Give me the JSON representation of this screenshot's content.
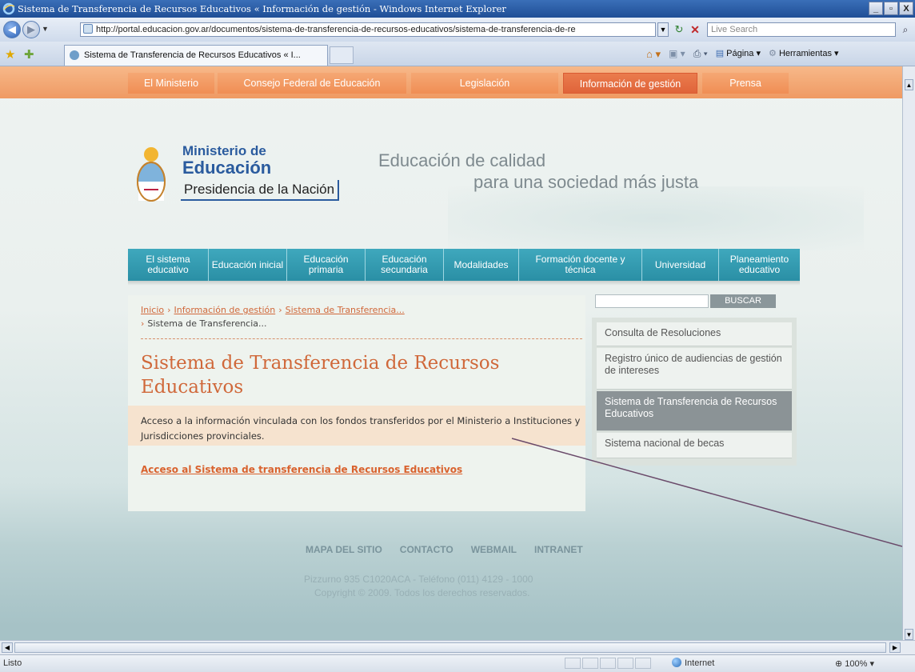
{
  "window": {
    "title": "Sistema de Transferencia de Recursos Educativos « Información de gestión - Windows Internet Explorer",
    "minimize": "_",
    "restore": "ā",
    "close": "X"
  },
  "address": {
    "url": "http://portal.educacion.gov.ar/documentos/sistema-de-transferencia-de-recursos-educativos/sistema-de-transferencia-de-re",
    "search_placeholder": "Live Search"
  },
  "tabs": [
    {
      "label": "Sistema de Transferencia de Recursos Educativos « I..."
    }
  ],
  "command_bar": {
    "page": "Página",
    "tools": "Herramientas"
  },
  "top_nav": [
    {
      "label": "El Ministerio"
    },
    {
      "label": "Consejo Federal de Educación"
    },
    {
      "label": "Legislación"
    },
    {
      "label": "Información de gestión"
    },
    {
      "label": "Prensa"
    }
  ],
  "logo": {
    "line1": "Ministerio de",
    "line2": "Educación",
    "line3": "Presidencia de la Nación"
  },
  "slogan": {
    "line1": "Educación de calidad",
    "line2": "para una sociedad más justa"
  },
  "sec_nav": [
    {
      "label": "El sistema educativo"
    },
    {
      "label": "Educación inicial"
    },
    {
      "label": "Educación primaria"
    },
    {
      "label": "Educación secundaria"
    },
    {
      "label": "Modalidades"
    },
    {
      "label": "Formación docente y técnica"
    },
    {
      "label": "Universidad"
    },
    {
      "label": "Planeamiento educativo"
    }
  ],
  "breadcrumb": {
    "home": "Inicio",
    "section": "Información de gestión",
    "parent": "Sistema de Transferencia...",
    "current": "Sistema de Transferencia..."
  },
  "main": {
    "title": "Sistema de Transferencia de Recursos Educativos",
    "description": "Acceso a la información vinculada con los fondos transferidos por el Ministerio a Instituciones y Jurisdicciones provinciales.",
    "access_link": "Acceso al Sistema de transferencia de Recursos Educativos"
  },
  "search": {
    "button": "BUSCAR"
  },
  "sidebar": [
    {
      "label": "Consulta de Resoluciones"
    },
    {
      "label": "Registro único de audiencias de gestión de intereses"
    },
    {
      "label": "Sistema de Transferencia de Recursos Educativos"
    },
    {
      "label": "Sistema nacional de becas"
    }
  ],
  "footer": {
    "links": [
      {
        "label": "MAPA DEL SITIO"
      },
      {
        "label": "CONTACTO"
      },
      {
        "label": "WEBMAIL"
      },
      {
        "label": "INTRANET"
      }
    ],
    "address": "Pizzurno 935 C1020ACA - Teléfono (011) 4129 - 1000",
    "copyright": "Copyright © 2009. Todos los derechos reservados."
  },
  "status": {
    "text": "Listo",
    "zone": "Internet",
    "zoom": "100%"
  },
  "colors": {
    "accent_orange": "#d0683a",
    "nav_teal": "#2a8fa5",
    "brand_blue": "#2a5b9e"
  }
}
